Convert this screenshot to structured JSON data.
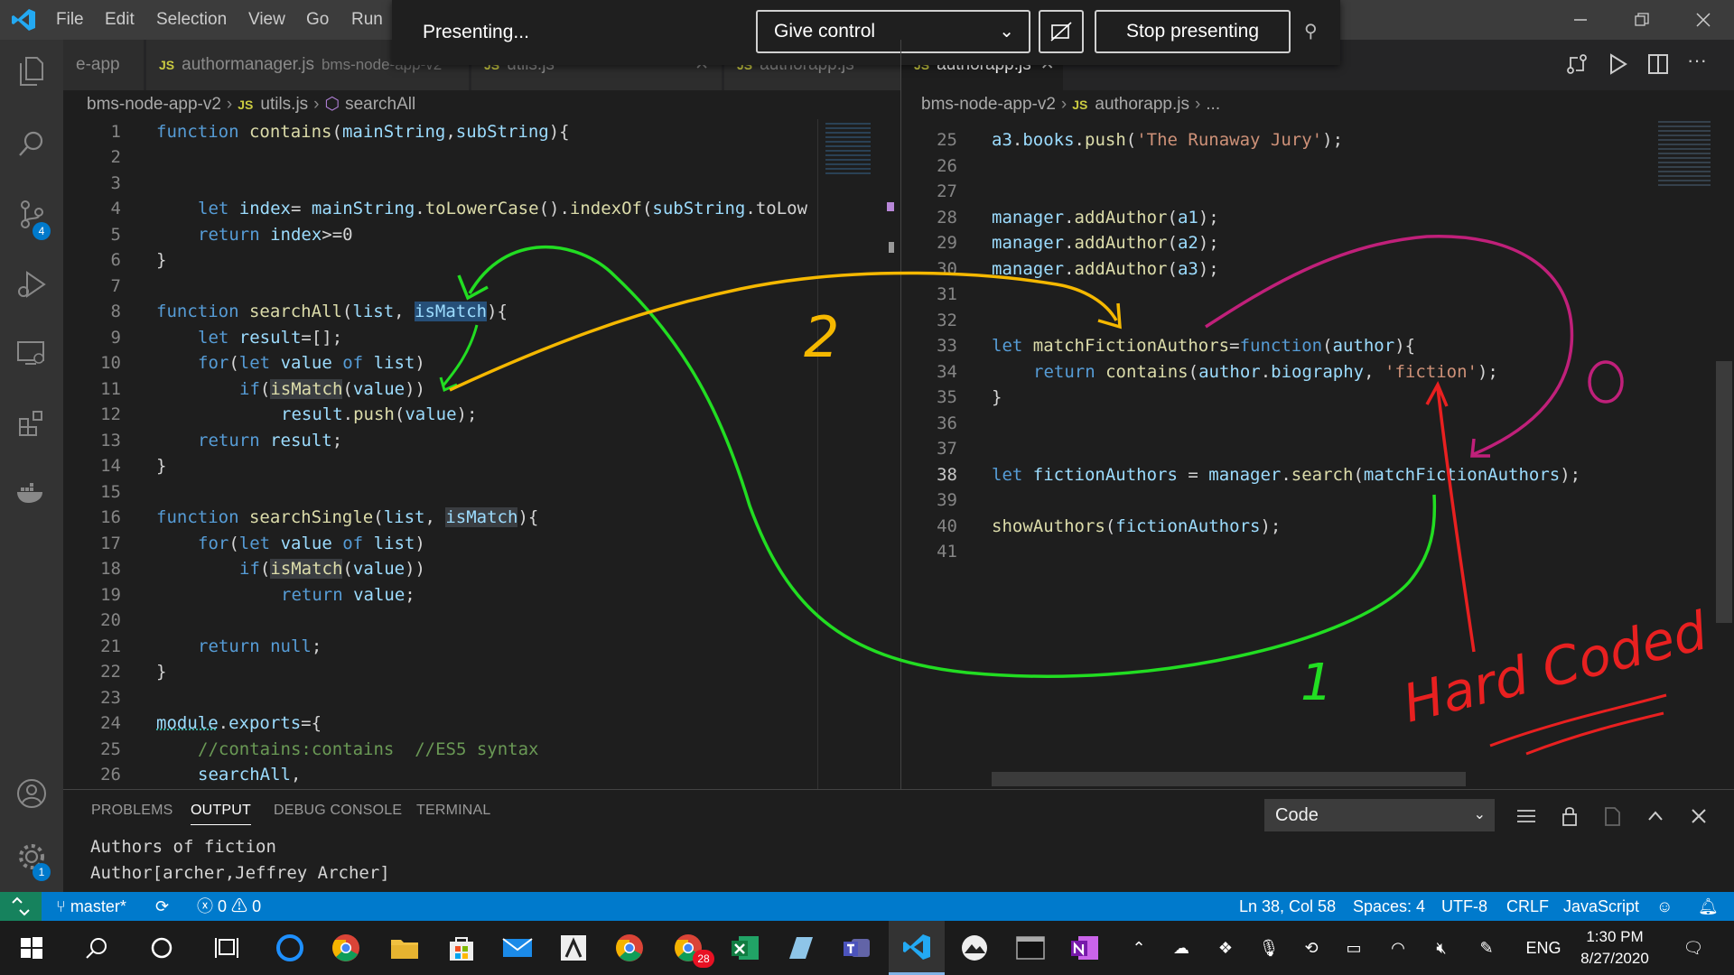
{
  "menu": [
    "File",
    "Edit",
    "Selection",
    "View",
    "Go",
    "Run"
  ],
  "presenting": {
    "status": "Presenting...",
    "give_control": "Give control",
    "stop": "Stop presenting"
  },
  "tabs_left": [
    {
      "label": "e-app",
      "desc": ""
    },
    {
      "label": "authormanager.js",
      "desc": "bms-node-app-v2"
    },
    {
      "label": "utils.js",
      "desc": ""
    },
    {
      "label": "authorapp.js",
      "desc": ""
    }
  ],
  "tabs_right": [
    {
      "label": "authorapp.js",
      "desc": ""
    }
  ],
  "breadcrumb_left": [
    "bms-node-app-v2",
    "utils.js",
    "searchAll"
  ],
  "breadcrumb_right": [
    "bms-node-app-v2",
    "authorapp.js",
    "..."
  ],
  "activity_badges": {
    "source_control": "4",
    "settings": "1"
  },
  "left_line_numbers": [
    "1",
    "2",
    "3",
    "4",
    "5",
    "6",
    "7",
    "8",
    "9",
    "10",
    "11",
    "12",
    "13",
    "14",
    "15",
    "16",
    "17",
    "18",
    "19",
    "20",
    "21",
    "22",
    "23",
    "24",
    "25",
    "26"
  ],
  "left_code": {
    "l1a": "function",
    "l1b": "contains",
    "l1c": "(",
    "l1d": "mainString",
    "l1e": ",",
    "l1f": "subString",
    "l1g": "){",
    "l4a": "let",
    "l4b": "index",
    "l4c": "= ",
    "l4d": "mainString",
    "l4e": ".",
    "l4f": "toLowerCase",
    "l4g": "().",
    "l4h": "indexOf",
    "l4i": "(",
    "l4j": "subString",
    "l4k": ".toLow",
    "l5a": "return",
    "l5b": "index",
    "l5c": ">=0",
    "l6": "}",
    "l8a": "function",
    "l8b": "searchAll",
    "l8c": "(",
    "l8d": "list",
    "l8e": ", ",
    "l8f": "isMatch",
    "l8g": "){",
    "l9a": "let",
    "l9b": "result",
    "l9c": "=[];",
    "l10a": "for",
    "l10b": "(",
    "l10c": "let",
    "l10d": "value",
    "l10e": "of",
    "l10f": "list",
    "l10g": ")",
    "l11a": "if",
    "l11b": "(",
    "l11c": "isMatch",
    "l11d": "(",
    "l11e": "value",
    "l11f": "))",
    "l12a": "result",
    "l12b": ".",
    "l12c": "push",
    "l12d": "(",
    "l12e": "value",
    "l12f": ");",
    "l13a": "return",
    "l13b": "result",
    "l13c": ";",
    "l14": "}",
    "l16a": "function",
    "l16b": "searchSingle",
    "l16c": "(",
    "l16d": "list",
    "l16e": ", ",
    "l16f": "isMatch",
    "l16g": "){",
    "l17a": "for",
    "l17b": "(",
    "l17c": "let",
    "l17d": "value",
    "l17e": "of",
    "l17f": "list",
    "l17g": ")",
    "l18a": "if",
    "l18b": "(",
    "l18c": "isMatch",
    "l18d": "(",
    "l18e": "value",
    "l18f": "))",
    "l19a": "return",
    "l19b": "value",
    "l19c": ";",
    "l21a": "return",
    "l21b": "null",
    "l21c": ";",
    "l22": "}",
    "l24a": "module",
    "l24b": ".",
    "l24c": "exports",
    "l24d": "={",
    "l25": "//contains:contains  //ES5 syntax",
    "l26a": "searchAll",
    "l26b": ","
  },
  "right_line_numbers": [
    "25",
    "26",
    "27",
    "28",
    "29",
    "30",
    "31",
    "32",
    "33",
    "34",
    "35",
    "36",
    "37",
    "38",
    "39",
    "40",
    "41"
  ],
  "right_code": {
    "r25a": "a3",
    "r25b": ".",
    "r25c": "books",
    "r25d": ".",
    "r25e": "push",
    "r25f": "(",
    "r25g": "'The Runaway Jury'",
    "r25h": ");",
    "r28a": "manager",
    "r28b": ".",
    "r28c": "addAuthor",
    "r28d": "(",
    "r28e": "a1",
    "r28f": ");",
    "r29a": "manager",
    "r29b": ".",
    "r29c": "addAuthor",
    "r29d": "(",
    "r29e": "a2",
    "r29f": ");",
    "r30a": "manager",
    "r30b": ".",
    "r30c": "addAuthor",
    "r30d": "(",
    "r30e": "a3",
    "r30f": ");",
    "r33a": "let",
    "r33b": "matchFictionAuthors",
    "r33c": "=",
    "r33d": "function",
    "r33e": "(",
    "r33f": "author",
    "r33g": "){",
    "r34a": "return",
    "r34b": "contains",
    "r34c": "(",
    "r34d": "author",
    "r34e": ".",
    "r34f": "biography",
    "r34g": ", ",
    "r34h": "'fiction'",
    "r34i": ");",
    "r35": "}",
    "r38a": "let",
    "r38b": "fictionAuthors",
    "r38c": " = ",
    "r38d": "manager",
    "r38e": ".",
    "r38f": "search",
    "r38g": "(",
    "r38h": "matchFictionAuthors",
    "r38i": ");",
    "r40a": "showAuthors",
    "r40b": "(",
    "r40c": "fictionAuthors",
    "r40d": ");"
  },
  "panel": {
    "tabs": [
      "PROBLEMS",
      "OUTPUT",
      "DEBUG CONSOLE",
      "TERMINAL"
    ],
    "output_channel": "Code",
    "output_lines": [
      "Authors of fiction",
      "Author[archer,Jeffrey Archer]"
    ]
  },
  "status": {
    "branch": "master*",
    "errors": "0",
    "warnings": "0",
    "position": "Ln 38, Col 58",
    "spaces": "Spaces: 4",
    "encoding": "UTF-8",
    "eol": "CRLF",
    "language": "JavaScript"
  },
  "taskbar": {
    "chrome_badge": "28",
    "lang": "ENG",
    "time": "1:30 PM",
    "date": "8/27/2020"
  },
  "annotations": {
    "label_1": "1",
    "label_2": "2",
    "label_0": "0",
    "hard_coded": "Hard Coded",
    "colors": {
      "green": "#22dd22",
      "yellow": "#f5b800",
      "magenta": "#c0207a",
      "red": "#e82020"
    }
  },
  "colors": {
    "accent": "#007acc",
    "keyword": "#569cd6",
    "function": "#dcdcaa",
    "variable": "#9cdcfe",
    "string": "#ce9178",
    "comment": "#6a9955"
  }
}
